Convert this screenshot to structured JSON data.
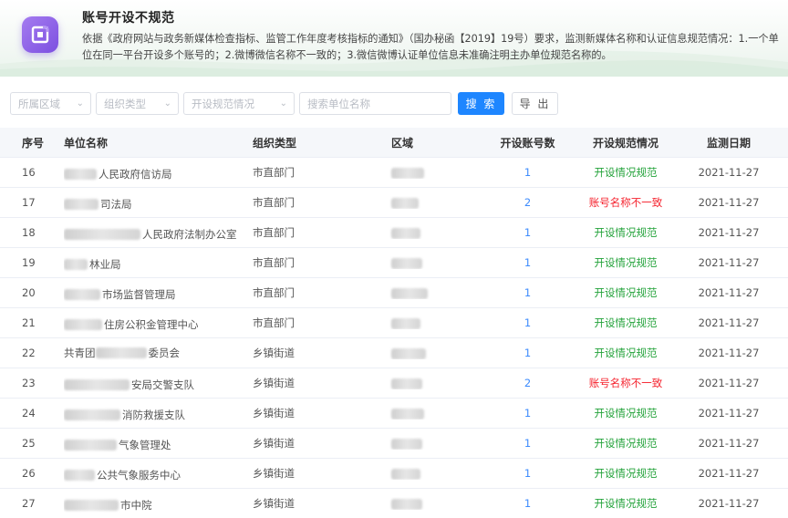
{
  "header": {
    "title": "账号开设不规范",
    "description": "依据《政府网站与政务新媒体检查指标、监管工作年度考核指标的通知》（国办秘函【2019】19号）要求，监测新媒体名称和认证信息规范情况：1.一个单位在同一平台开设多个账号的；2.微博微信名称不一致的；3.微信微博认证单位信息未准确注明主办单位规范名称的。"
  },
  "toolbar": {
    "region_select": "所属区域",
    "org_type_select": "组织类型",
    "status_select": "开设规范情况",
    "search_placeholder": "搜索单位名称",
    "search_button": "搜 索",
    "export_button": "导 出"
  },
  "colors": {
    "primary": "#1e86ff",
    "ok": "#23a23a",
    "bad": "#f5222d",
    "link": "#3d8bfd",
    "icon_bg": "#8a5ce6"
  },
  "icons": {
    "logo": "document-frame-icon",
    "dropdown": "chevron-down-icon"
  },
  "table": {
    "columns": [
      "序号",
      "单位名称",
      "组织类型",
      "区域",
      "开设账号数",
      "开设规范情况",
      "监测日期"
    ],
    "rows": [
      {
        "no": "16",
        "name_prefix": "",
        "name": "人民政府信访局",
        "type": "市直部门",
        "count": "1",
        "status": "开设情况规范",
        "ok": true,
        "date": "2021-11-27"
      },
      {
        "no": "17",
        "name_prefix": "",
        "name": "司法局",
        "type": "市直部门",
        "count": "2",
        "status": "账号名称不一致",
        "ok": false,
        "date": "2021-11-27"
      },
      {
        "no": "18",
        "name_prefix": "",
        "name": "人民政府法制办公室",
        "type": "市直部门",
        "count": "1",
        "status": "开设情况规范",
        "ok": true,
        "date": "2021-11-27"
      },
      {
        "no": "19",
        "name_prefix": "",
        "name": "林业局",
        "type": "市直部门",
        "count": "1",
        "status": "开设情况规范",
        "ok": true,
        "date": "2021-11-27"
      },
      {
        "no": "20",
        "name_prefix": "",
        "name": "市场监督管理局",
        "type": "市直部门",
        "count": "1",
        "status": "开设情况规范",
        "ok": true,
        "date": "2021-11-27"
      },
      {
        "no": "21",
        "name_prefix": "",
        "name": "住房公积金管理中心",
        "type": "市直部门",
        "count": "1",
        "status": "开设情况规范",
        "ok": true,
        "date": "2021-11-27"
      },
      {
        "no": "22",
        "name_prefix": "共青团",
        "name": "委员会",
        "type": "乡镇街道",
        "count": "1",
        "status": "开设情况规范",
        "ok": true,
        "date": "2021-11-27"
      },
      {
        "no": "23",
        "name_prefix": "",
        "name": "安局交警支队",
        "type": "乡镇街道",
        "count": "2",
        "status": "账号名称不一致",
        "ok": false,
        "date": "2021-11-27"
      },
      {
        "no": "24",
        "name_prefix": "",
        "name": "消防救援支队",
        "type": "乡镇街道",
        "count": "1",
        "status": "开设情况规范",
        "ok": true,
        "date": "2021-11-27"
      },
      {
        "no": "25",
        "name_prefix": "",
        "name": "气象管理处",
        "type": "乡镇街道",
        "count": "1",
        "status": "开设情况规范",
        "ok": true,
        "date": "2021-11-27"
      },
      {
        "no": "26",
        "name_prefix": "",
        "name": "公共气象服务中心",
        "type": "乡镇街道",
        "count": "1",
        "status": "开设情况规范",
        "ok": true,
        "date": "2021-11-27"
      },
      {
        "no": "27",
        "name_prefix": "",
        "name": "市中院",
        "type": "乡镇街道",
        "count": "1",
        "status": "开设情况规范",
        "ok": true,
        "date": "2021-11-27"
      }
    ]
  }
}
